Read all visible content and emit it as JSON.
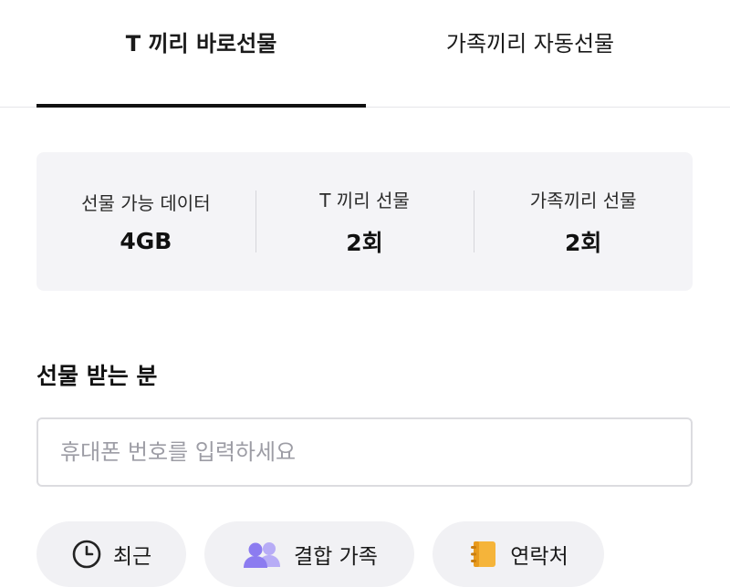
{
  "tabs": [
    {
      "label": "T 끼리 바로선물",
      "active": true
    },
    {
      "label": "가족끼리 자동선물",
      "active": false
    }
  ],
  "summary": [
    {
      "label": "선물 가능 데이터",
      "value": "4GB"
    },
    {
      "label": "T 끼리 선물",
      "value": "2회"
    },
    {
      "label": "가족끼리 선물",
      "value": "2회"
    }
  ],
  "recipient": {
    "title": "선물 받는 분",
    "placeholder": "휴대폰 번호를 입력하세요"
  },
  "chips": [
    {
      "label": "최근",
      "icon": "clock-icon"
    },
    {
      "label": "결합 가족",
      "icon": "people-icon"
    },
    {
      "label": "연락처",
      "icon": "contacts-book-icon"
    }
  ],
  "colors": {
    "active_tab_indicator": "#111111",
    "summary_bg": "#f4f4f7",
    "chip_bg": "#f1f1f4",
    "people_icon": "#8c7cf0",
    "contacts_icon": "#f5b43a"
  }
}
